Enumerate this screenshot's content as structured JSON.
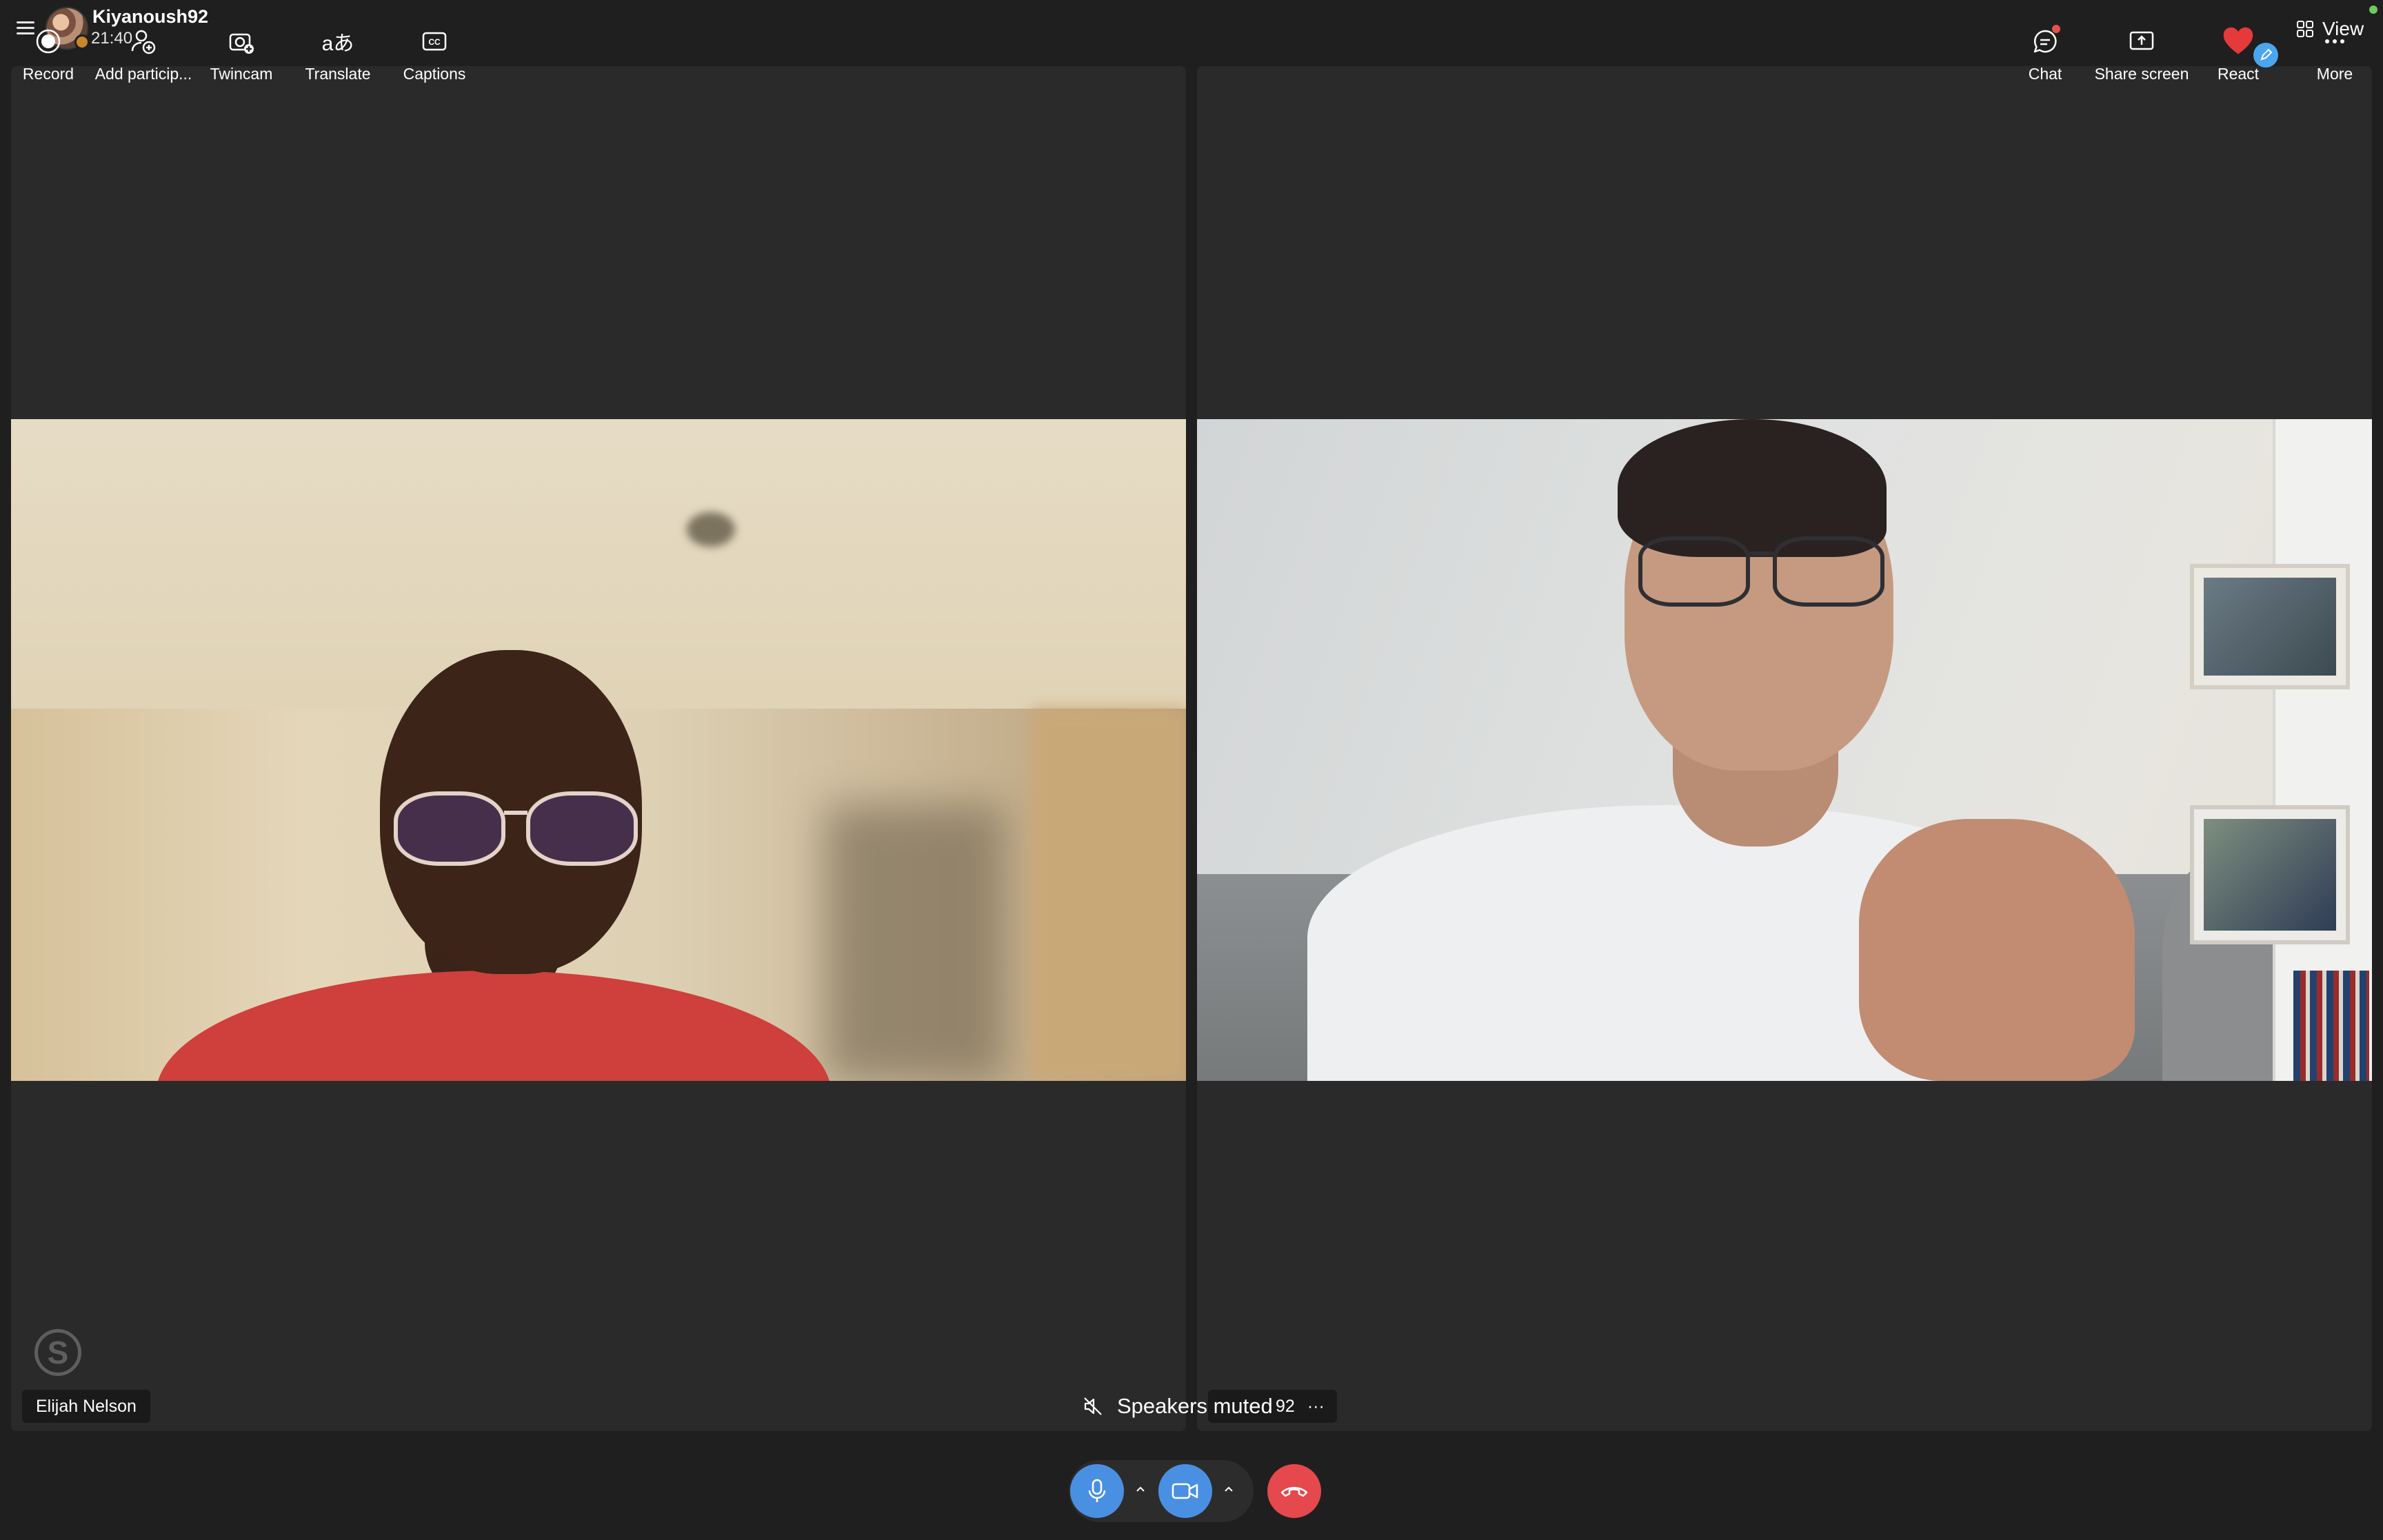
{
  "header": {
    "caller_name": "Kiyanoush92",
    "call_time": "21:40",
    "view_label": "View"
  },
  "participants": {
    "left_name": "Elijah Nelson",
    "right_name_partial": "92",
    "right_more": "···"
  },
  "notification": {
    "text": "Speakers muted"
  },
  "toolbar": {
    "record": "Record",
    "add_participant": "Add particip...",
    "twincam": "Twincam",
    "translate": "Translate",
    "translate_glyph": "aあ",
    "captions": "Captions",
    "chat": "Chat",
    "share_screen": "Share screen",
    "react": "React",
    "more": "More"
  },
  "colors": {
    "accent_blue": "#4a90e2",
    "end_call_red": "#e5484d",
    "background": "#1f1f1f",
    "tile": "#2a2a2a"
  }
}
